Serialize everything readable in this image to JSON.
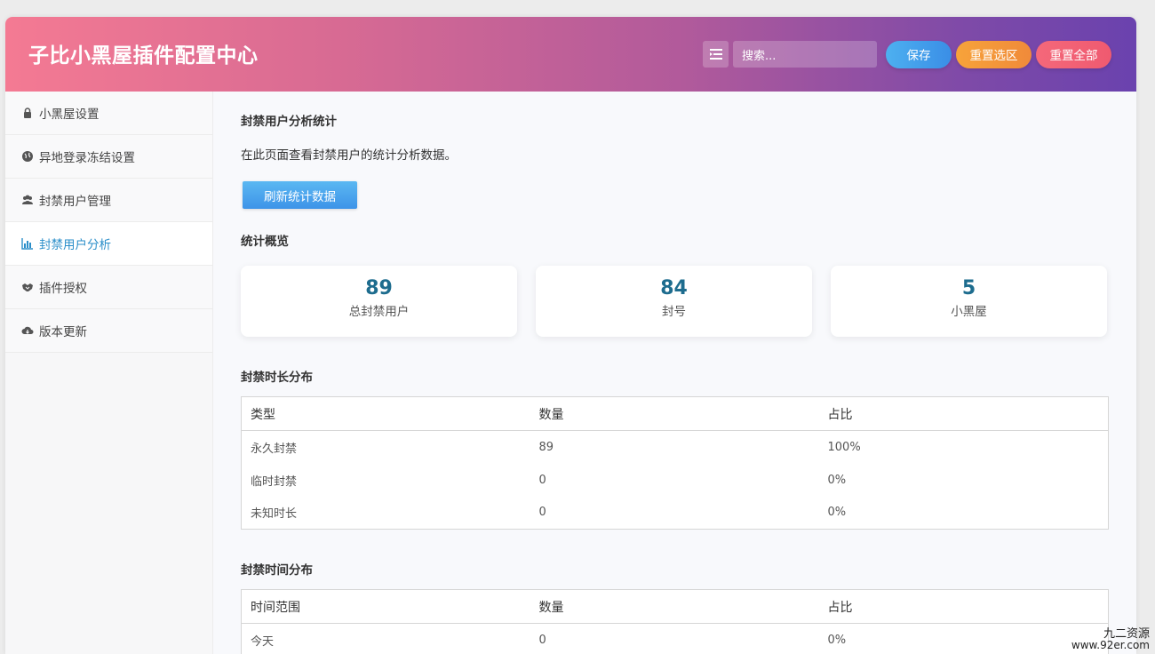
{
  "header": {
    "title": "子比小黑屋插件配置中心",
    "search_placeholder": "搜索...",
    "save_label": "保存",
    "reset_selection_label": "重置选区",
    "reset_all_label": "重置全部"
  },
  "sidebar": {
    "items": [
      {
        "label": "小黑屋设置",
        "icon": "lock-icon"
      },
      {
        "label": "异地登录冻结设置",
        "icon": "globe-icon"
      },
      {
        "label": "封禁用户管理",
        "icon": "users-icon"
      },
      {
        "label": "封禁用户分析",
        "icon": "bar-chart-icon"
      },
      {
        "label": "插件授权",
        "icon": "handshake-icon"
      },
      {
        "label": "版本更新",
        "icon": "cloud-download-icon"
      }
    ],
    "active_index": 3
  },
  "main": {
    "section_title": "封禁用户分析统计",
    "description": "在此页面查看封禁用户的统计分析数据。",
    "refresh_label": "刷新统计数据",
    "overview_title": "统计概览",
    "cards": [
      {
        "value": "89",
        "label": "总封禁用户"
      },
      {
        "value": "84",
        "label": "封号"
      },
      {
        "value": "5",
        "label": "小黑屋"
      }
    ],
    "duration_title": "封禁时长分布",
    "duration_table": {
      "headers": [
        "类型",
        "数量",
        "占比"
      ],
      "rows": [
        [
          "永久封禁",
          "89",
          "100%"
        ],
        [
          "临时封禁",
          "0",
          "0%"
        ],
        [
          "未知时长",
          "0",
          "0%"
        ]
      ]
    },
    "time_title": "封禁时间分布",
    "time_table": {
      "headers": [
        "时间范围",
        "数量",
        "占比"
      ],
      "rows": [
        [
          "今天",
          "0",
          "0%"
        ]
      ]
    }
  },
  "watermark": {
    "line1": "九二资源",
    "line2": "www.92er.com"
  },
  "colors": {
    "accent": "#2a8ec9",
    "card_number": "#1d6c8e",
    "save": "#3a8ee6",
    "reset_selection": "#f08a3a",
    "reset_all": "#ef5a70"
  }
}
